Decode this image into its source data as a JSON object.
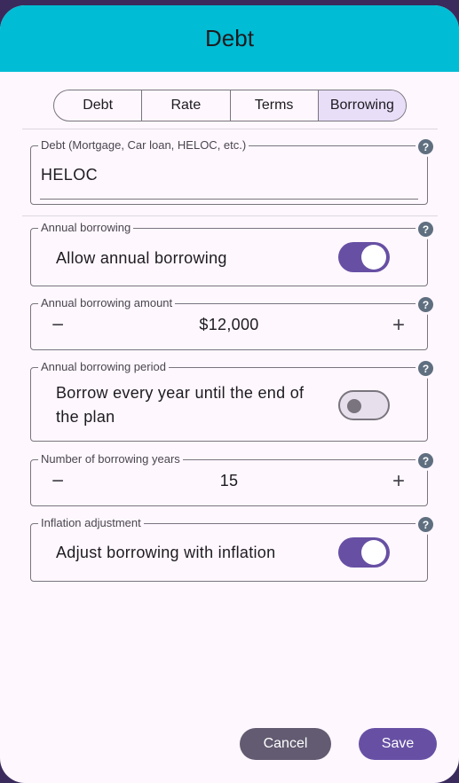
{
  "dialog": {
    "title": "Debt"
  },
  "tabs": [
    "Debt",
    "Rate",
    "Terms",
    "Borrowing"
  ],
  "selected_tab": "Borrowing",
  "debt_field": {
    "label": "Debt (Mortgage, Car loan, HELOC, etc.)",
    "value": "HELOC"
  },
  "annual_borrowing": {
    "label": "Annual borrowing",
    "text": "Allow annual borrowing",
    "enabled": true
  },
  "borrowing_amount": {
    "label": "Annual borrowing amount",
    "value": "$12,000"
  },
  "borrowing_period": {
    "label": "Annual borrowing period",
    "text_line1": "Borrow every year until the end of",
    "text_line2": "the plan",
    "enabled": false
  },
  "borrowing_years": {
    "label": "Number of borrowing years",
    "value": "15"
  },
  "inflation": {
    "label": "Inflation adjustment",
    "text": "Adjust borrowing with inflation",
    "enabled": true
  },
  "actions": {
    "cancel": "Cancel",
    "save": "Save"
  },
  "icons": {
    "help": "?",
    "minus": "−",
    "plus": "+"
  },
  "colors": {
    "header": "#00bcd4",
    "accent": "#6750a4",
    "cancel": "#625b71"
  }
}
